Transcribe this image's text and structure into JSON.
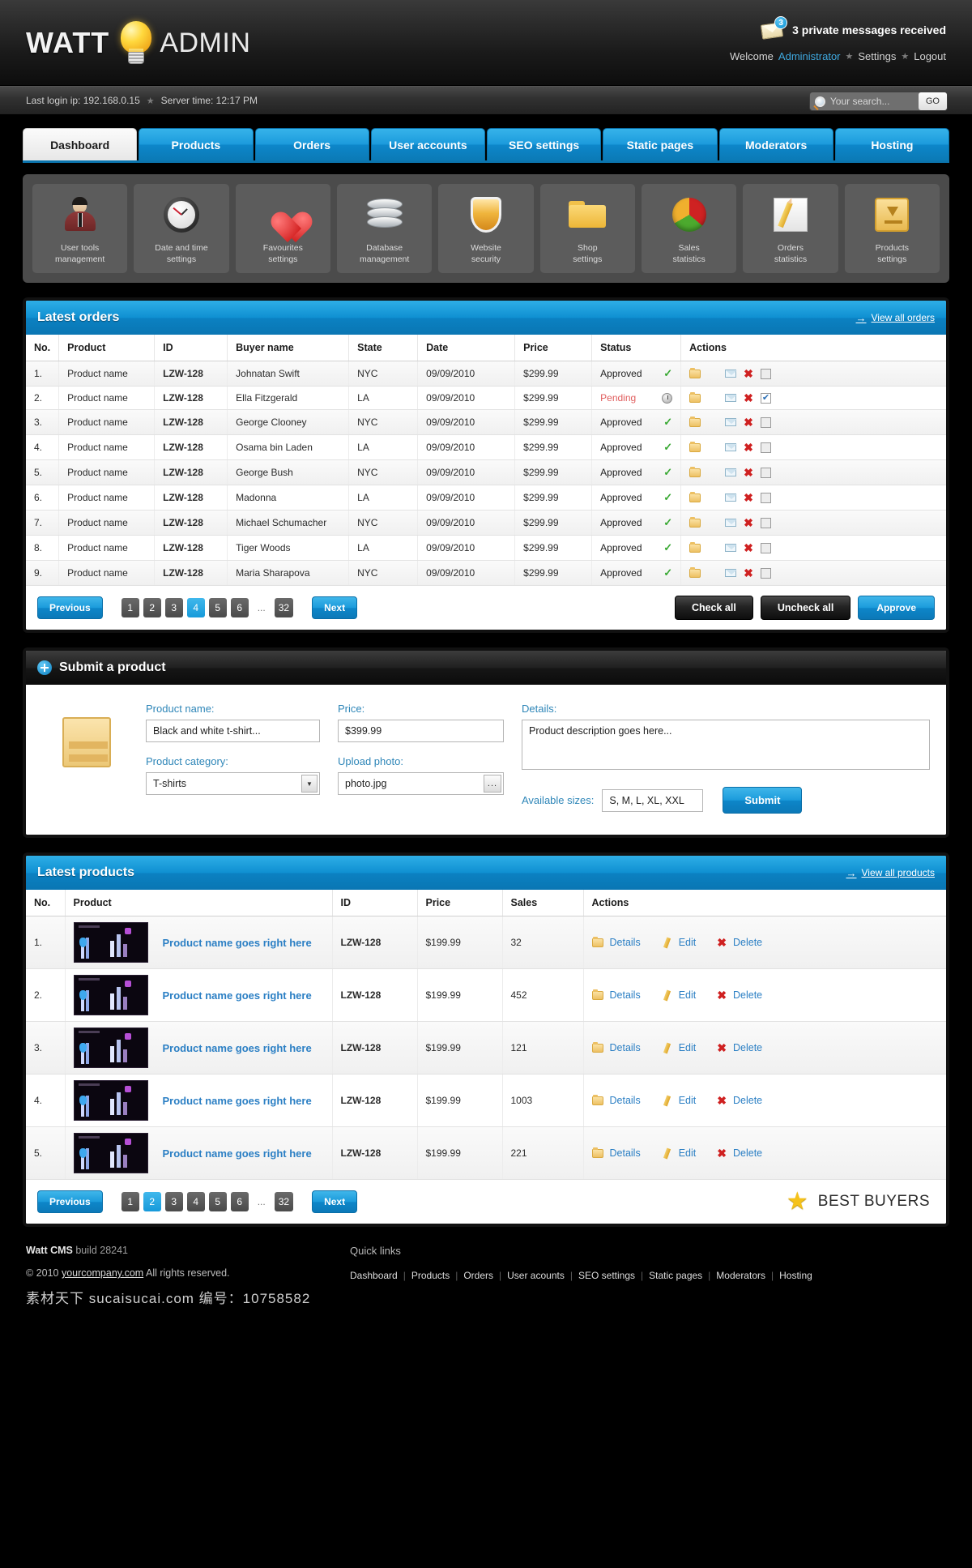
{
  "header": {
    "logo_first": "WATT",
    "logo_second": "ADMIN",
    "bulb_icon": "lightbulb-icon",
    "messages_count": "3",
    "messages_text": "3 private messages received",
    "welcome_prefix": "Welcome",
    "admin_name": "Administrator",
    "settings_link": "Settings",
    "logout_link": "Logout"
  },
  "subbar": {
    "last_login": "Last login ip: 192.168.0.15",
    "server_time": "Server time: 12:17 PM",
    "search_placeholder": "Your search...",
    "search_value": "",
    "go_label": "GO"
  },
  "tabs": [
    {
      "label": "Dashboard",
      "active": true
    },
    {
      "label": "Products",
      "active": false
    },
    {
      "label": "Orders",
      "active": false
    },
    {
      "label": "User accounts",
      "active": false
    },
    {
      "label": "SEO settings",
      "active": false
    },
    {
      "label": "Static pages",
      "active": false
    },
    {
      "label": "Moderators",
      "active": false
    },
    {
      "label": "Hosting",
      "active": false
    }
  ],
  "shortcuts": [
    {
      "icon": "user-icon",
      "line1": "User tools",
      "line2": "management"
    },
    {
      "icon": "clock-icon",
      "line1": "Date and time",
      "line2": "settings"
    },
    {
      "icon": "heart-icon",
      "line1": "Favourites",
      "line2": "settings"
    },
    {
      "icon": "database-icon",
      "line1": "Database",
      "line2": "management"
    },
    {
      "icon": "shield-icon",
      "line1": "Website",
      "line2": "security"
    },
    {
      "icon": "folder-icon",
      "line1": "Shop",
      "line2": "settings"
    },
    {
      "icon": "pie-chart-icon",
      "line1": "Sales",
      "line2": "statistics"
    },
    {
      "icon": "pencil-icon",
      "line1": "Orders",
      "line2": "statistics"
    },
    {
      "icon": "box-icon",
      "line1": "Products",
      "line2": "settings"
    }
  ],
  "orders_panel": {
    "title": "Latest orders",
    "view_all": "View all orders",
    "columns": [
      "No.",
      "Product",
      "ID",
      "Buyer name",
      "State",
      "Date",
      "Price",
      "Status",
      "Actions"
    ],
    "rows": [
      {
        "no": "1.",
        "product": "Product name",
        "id": "LZW-128",
        "buyer": "Johnatan Swift",
        "state": "NYC",
        "date": "09/09/2010",
        "price": "$299.99",
        "status": "Approved",
        "checked": false
      },
      {
        "no": "2.",
        "product": "Product name",
        "id": "LZW-128",
        "buyer": "Ella Fitzgerald",
        "state": "LA",
        "date": "09/09/2010",
        "price": "$299.99",
        "status": "Pending",
        "checked": true
      },
      {
        "no": "3.",
        "product": "Product name",
        "id": "LZW-128",
        "buyer": "George Clooney",
        "state": "NYC",
        "date": "09/09/2010",
        "price": "$299.99",
        "status": "Approved",
        "checked": false
      },
      {
        "no": "4.",
        "product": "Product name",
        "id": "LZW-128",
        "buyer": "Osama bin Laden",
        "state": "LA",
        "date": "09/09/2010",
        "price": "$299.99",
        "status": "Approved",
        "checked": false
      },
      {
        "no": "5.",
        "product": "Product name",
        "id": "LZW-128",
        "buyer": "George Bush",
        "state": "NYC",
        "date": "09/09/2010",
        "price": "$299.99",
        "status": "Approved",
        "checked": false
      },
      {
        "no": "6.",
        "product": "Product name",
        "id": "LZW-128",
        "buyer": "Madonna",
        "state": "LA",
        "date": "09/09/2010",
        "price": "$299.99",
        "status": "Approved",
        "checked": false
      },
      {
        "no": "7.",
        "product": "Product name",
        "id": "LZW-128",
        "buyer": "Michael Schumacher",
        "state": "NYC",
        "date": "09/09/2010",
        "price": "$299.99",
        "status": "Approved",
        "checked": false
      },
      {
        "no": "8.",
        "product": "Product name",
        "id": "LZW-128",
        "buyer": "Tiger Woods",
        "state": "LA",
        "date": "09/09/2010",
        "price": "$299.99",
        "status": "Approved",
        "checked": false
      },
      {
        "no": "9.",
        "product": "Product name",
        "id": "LZW-128",
        "buyer": "Maria Sharapova",
        "state": "NYC",
        "date": "09/09/2010",
        "price": "$299.99",
        "status": "Approved",
        "checked": false
      }
    ],
    "pagination": {
      "previous": "Previous",
      "next": "Next",
      "pages": [
        "1",
        "2",
        "3",
        "4",
        "5",
        "6",
        "...",
        "32"
      ],
      "active_page": "4"
    },
    "check_all": "Check all",
    "uncheck_all": "Uncheck all",
    "approve": "Approve"
  },
  "submit_panel": {
    "title": "Submit a product",
    "icon": "plus-circle-icon",
    "crate_icon": "crate-icon",
    "product_name_label": "Product name:",
    "product_name_value": "Black and white t-shirt...",
    "price_label": "Price:",
    "price_value": "$399.99",
    "details_label": "Details:",
    "details_value": "Product description goes here...",
    "category_label": "Product category:",
    "category_value": "T-shirts",
    "upload_label": "Upload photo:",
    "upload_value": "photo.jpg",
    "browse_label": "...",
    "sizes_label": "Available sizes:",
    "sizes_value": "S, M, L, XL, XXL",
    "submit_label": "Submit"
  },
  "products_panel": {
    "title": "Latest products",
    "view_all": "View all products",
    "columns": [
      "No.",
      "Product",
      "ID",
      "Price",
      "Sales",
      "Actions"
    ],
    "action_labels": {
      "details": "Details",
      "edit": "Edit",
      "delete": "Delete"
    },
    "rows": [
      {
        "no": "1.",
        "name": "Product name goes right here",
        "id": "LZW-128",
        "price": "$199.99",
        "sales": "32"
      },
      {
        "no": "2.",
        "name": "Product name goes right here",
        "id": "LZW-128",
        "price": "$199.99",
        "sales": "452"
      },
      {
        "no": "3.",
        "name": "Product name goes right here",
        "id": "LZW-128",
        "price": "$199.99",
        "sales": "121"
      },
      {
        "no": "4.",
        "name": "Product name goes right here",
        "id": "LZW-128",
        "price": "$199.99",
        "sales": "1003"
      },
      {
        "no": "5.",
        "name": "Product name goes right here",
        "id": "LZW-128",
        "price": "$199.99",
        "sales": "221"
      }
    ],
    "pagination": {
      "previous": "Previous",
      "next": "Next",
      "pages": [
        "1",
        "2",
        "3",
        "4",
        "5",
        "6",
        "...",
        "32"
      ],
      "active_page": "2"
    },
    "best_buyers": "BEST BUYERS",
    "best_buyers_icon": "star-icon"
  },
  "footer": {
    "brand": "Watt CMS",
    "build": "build 28241",
    "copyright_prefix": "© 2010",
    "company_link": "yourcompany.com",
    "rights": "All rights reserved.",
    "watermark": "素材天下 sucaisucai.com 编号：10758582",
    "quick_links_title": "Quick links",
    "quick_links": [
      "Dashboard",
      "Products",
      "Orders",
      "User acounts",
      "SEO settings",
      "Static pages",
      "Moderators",
      "Hosting"
    ]
  }
}
